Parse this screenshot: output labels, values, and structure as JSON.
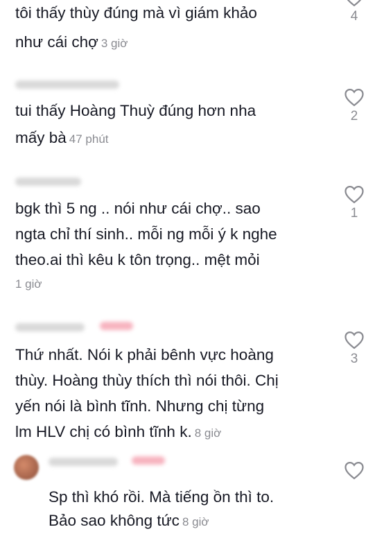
{
  "comments": [
    {
      "lines": [
        "tôi thấy thùy đúng mà vì giám khảo",
        "như cái chợ"
      ],
      "time": "3 giờ",
      "likes": "4"
    },
    {
      "lines": [
        "tui thấy Hoàng Thuỳ đúng hơn nha",
        "mấy bà"
      ],
      "time": "47 phút",
      "likes": "2"
    },
    {
      "lines": [
        "bgk thì 5 ng .. nói như cái chợ.. sao",
        "ngta chỉ thí sinh.. mỗi ng mỗi ý k nghe",
        "theo.ai thì kêu k tôn trọng.. mệt mỏi"
      ],
      "time": "1 giờ",
      "likes": "1"
    },
    {
      "lines": [
        "Thứ nhất. Nói k phải bênh vực hoàng",
        "thùy. Hoàng thùy thích thì nói thôi. Chị",
        "yến nói là bình tĩnh. Nhưng chị từng",
        "lm HLV chị có bình tĩnh k."
      ],
      "time": "8 giờ",
      "likes": "3"
    },
    {
      "lines": [
        "Sp thì khó rồi. Mà tiếng ồn thì to.",
        "Bảo sao không tức"
      ],
      "time": "8 giờ",
      "likes": ""
    }
  ],
  "icons": {
    "like": "heart-outline-icon"
  },
  "colors": {
    "text": "#161823",
    "muted": "#8a8b91",
    "blurred_name": "#d9d9d9",
    "author_badge": "#f7b3bf"
  }
}
